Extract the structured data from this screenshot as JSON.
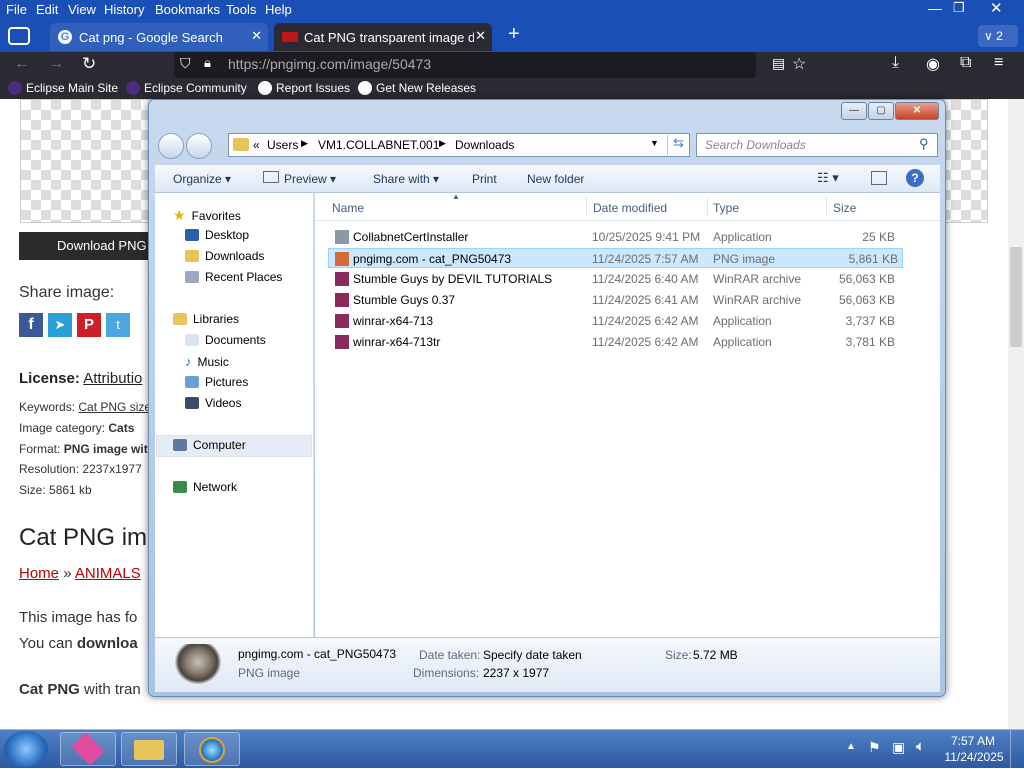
{
  "menu": [
    "File",
    "Edit",
    "View",
    "History",
    "Bookmarks",
    "Tools",
    "Help"
  ],
  "tabs": [
    {
      "title": "Cat png - Google Search"
    },
    {
      "title": "Cat PNG transparent image dov"
    }
  ],
  "tab_count": "2",
  "url": "https://pngimg.com/image/50473",
  "bookmarks": [
    "Eclipse Main Site",
    "Eclipse Community",
    "Report Issues",
    "Get New Releases"
  ],
  "page": {
    "download_btn": "Download PNG",
    "share_label": "Share image:",
    "license_label": "License:",
    "license_value": "Attributio",
    "keywords_label": "Keywords:",
    "keywords_value": "Cat PNG size",
    "category_label": "Image category:",
    "category_value": "Cats",
    "format_label": "Format:",
    "format_value": "PNG image with",
    "resolution_label": "Resolution:",
    "resolution_value": "2237x1977",
    "size_label": "Size:",
    "size_value": "5861 kb",
    "heading": "Cat PNG im",
    "crumb_home": "Home",
    "crumb_sep": "»",
    "crumb_animals": "ANIMALS",
    "para1": "This image has fo",
    "para2_pre": "You can",
    "para2_bold": "downloa",
    "para3_bold": "Cat PNG",
    "para3_rest": " with tran"
  },
  "explorer": {
    "path": [
      "«",
      "Users",
      "VM1.COLLABNET.001",
      "Downloads"
    ],
    "search_placeholder": "Search Downloads",
    "commands": [
      "Organize",
      "Preview",
      "Share with",
      "Print",
      "New folder"
    ],
    "nav": {
      "favorites": "Favorites",
      "fav_items": [
        "Desktop",
        "Downloads",
        "Recent Places"
      ],
      "libraries": "Libraries",
      "lib_items": [
        "Documents",
        "Music",
        "Pictures",
        "Videos"
      ],
      "computer": "Computer",
      "network": "Network"
    },
    "columns": [
      "Name",
      "Date modified",
      "Type",
      "Size"
    ],
    "files": [
      {
        "name": "CollabnetCertInstaller",
        "date": "10/25/2025 9:41 PM",
        "type": "Application",
        "size": "25 KB",
        "icon": "app-icon"
      },
      {
        "name": "pngimg.com - cat_PNG50473",
        "date": "11/24/2025 7:57 AM",
        "type": "PNG image",
        "size": "5,861 KB",
        "icon": "image-icon",
        "selected": true
      },
      {
        "name": "Stumble Guys  by DEVIL TUTORIALS",
        "date": "11/24/2025 6:40 AM",
        "type": "WinRAR archive",
        "size": "56,063 KB",
        "icon": "winrar-icon"
      },
      {
        "name": "Stumble Guys 0.37",
        "date": "11/24/2025 6:41 AM",
        "type": "WinRAR archive",
        "size": "56,063 KB",
        "icon": "winrar-icon"
      },
      {
        "name": "winrar-x64-713",
        "date": "11/24/2025 6:42 AM",
        "type": "Application",
        "size": "3,737 KB",
        "icon": "winrar-icon"
      },
      {
        "name": "winrar-x64-713tr",
        "date": "11/24/2025 6:42 AM",
        "type": "Application",
        "size": "3,781 KB",
        "icon": "winrar-icon"
      }
    ],
    "details": {
      "name": "pngimg.com - cat_PNG50473",
      "kind": "PNG image",
      "date_label": "Date taken:",
      "date_value": "Specify date taken",
      "dims_label": "Dimensions:",
      "dims_value": "2237 x 1977",
      "size_label": "Size:",
      "size_value": "5.72 MB"
    }
  },
  "clock": {
    "time": "7:57 AM",
    "date": "11/24/2025"
  }
}
